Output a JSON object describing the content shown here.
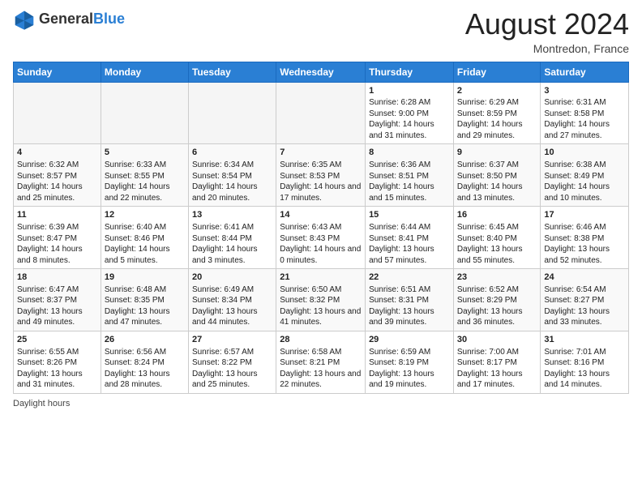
{
  "header": {
    "logo_general": "General",
    "logo_blue": "Blue",
    "month_year": "August 2024",
    "location": "Montredon, France"
  },
  "days_of_week": [
    "Sunday",
    "Monday",
    "Tuesday",
    "Wednesday",
    "Thursday",
    "Friday",
    "Saturday"
  ],
  "weeks": [
    [
      {
        "day": "",
        "info": ""
      },
      {
        "day": "",
        "info": ""
      },
      {
        "day": "",
        "info": ""
      },
      {
        "day": "",
        "info": ""
      },
      {
        "day": "1",
        "info": "Sunrise: 6:28 AM\nSunset: 9:00 PM\nDaylight: 14 hours and 31 minutes."
      },
      {
        "day": "2",
        "info": "Sunrise: 6:29 AM\nSunset: 8:59 PM\nDaylight: 14 hours and 29 minutes."
      },
      {
        "day": "3",
        "info": "Sunrise: 6:31 AM\nSunset: 8:58 PM\nDaylight: 14 hours and 27 minutes."
      }
    ],
    [
      {
        "day": "4",
        "info": "Sunrise: 6:32 AM\nSunset: 8:57 PM\nDaylight: 14 hours and 25 minutes."
      },
      {
        "day": "5",
        "info": "Sunrise: 6:33 AM\nSunset: 8:55 PM\nDaylight: 14 hours and 22 minutes."
      },
      {
        "day": "6",
        "info": "Sunrise: 6:34 AM\nSunset: 8:54 PM\nDaylight: 14 hours and 20 minutes."
      },
      {
        "day": "7",
        "info": "Sunrise: 6:35 AM\nSunset: 8:53 PM\nDaylight: 14 hours and 17 minutes."
      },
      {
        "day": "8",
        "info": "Sunrise: 6:36 AM\nSunset: 8:51 PM\nDaylight: 14 hours and 15 minutes."
      },
      {
        "day": "9",
        "info": "Sunrise: 6:37 AM\nSunset: 8:50 PM\nDaylight: 14 hours and 13 minutes."
      },
      {
        "day": "10",
        "info": "Sunrise: 6:38 AM\nSunset: 8:49 PM\nDaylight: 14 hours and 10 minutes."
      }
    ],
    [
      {
        "day": "11",
        "info": "Sunrise: 6:39 AM\nSunset: 8:47 PM\nDaylight: 14 hours and 8 minutes."
      },
      {
        "day": "12",
        "info": "Sunrise: 6:40 AM\nSunset: 8:46 PM\nDaylight: 14 hours and 5 minutes."
      },
      {
        "day": "13",
        "info": "Sunrise: 6:41 AM\nSunset: 8:44 PM\nDaylight: 14 hours and 3 minutes."
      },
      {
        "day": "14",
        "info": "Sunrise: 6:43 AM\nSunset: 8:43 PM\nDaylight: 14 hours and 0 minutes."
      },
      {
        "day": "15",
        "info": "Sunrise: 6:44 AM\nSunset: 8:41 PM\nDaylight: 13 hours and 57 minutes."
      },
      {
        "day": "16",
        "info": "Sunrise: 6:45 AM\nSunset: 8:40 PM\nDaylight: 13 hours and 55 minutes."
      },
      {
        "day": "17",
        "info": "Sunrise: 6:46 AM\nSunset: 8:38 PM\nDaylight: 13 hours and 52 minutes."
      }
    ],
    [
      {
        "day": "18",
        "info": "Sunrise: 6:47 AM\nSunset: 8:37 PM\nDaylight: 13 hours and 49 minutes."
      },
      {
        "day": "19",
        "info": "Sunrise: 6:48 AM\nSunset: 8:35 PM\nDaylight: 13 hours and 47 minutes."
      },
      {
        "day": "20",
        "info": "Sunrise: 6:49 AM\nSunset: 8:34 PM\nDaylight: 13 hours and 44 minutes."
      },
      {
        "day": "21",
        "info": "Sunrise: 6:50 AM\nSunset: 8:32 PM\nDaylight: 13 hours and 41 minutes."
      },
      {
        "day": "22",
        "info": "Sunrise: 6:51 AM\nSunset: 8:31 PM\nDaylight: 13 hours and 39 minutes."
      },
      {
        "day": "23",
        "info": "Sunrise: 6:52 AM\nSunset: 8:29 PM\nDaylight: 13 hours and 36 minutes."
      },
      {
        "day": "24",
        "info": "Sunrise: 6:54 AM\nSunset: 8:27 PM\nDaylight: 13 hours and 33 minutes."
      }
    ],
    [
      {
        "day": "25",
        "info": "Sunrise: 6:55 AM\nSunset: 8:26 PM\nDaylight: 13 hours and 31 minutes."
      },
      {
        "day": "26",
        "info": "Sunrise: 6:56 AM\nSunset: 8:24 PM\nDaylight: 13 hours and 28 minutes."
      },
      {
        "day": "27",
        "info": "Sunrise: 6:57 AM\nSunset: 8:22 PM\nDaylight: 13 hours and 25 minutes."
      },
      {
        "day": "28",
        "info": "Sunrise: 6:58 AM\nSunset: 8:21 PM\nDaylight: 13 hours and 22 minutes."
      },
      {
        "day": "29",
        "info": "Sunrise: 6:59 AM\nSunset: 8:19 PM\nDaylight: 13 hours and 19 minutes."
      },
      {
        "day": "30",
        "info": "Sunrise: 7:00 AM\nSunset: 8:17 PM\nDaylight: 13 hours and 17 minutes."
      },
      {
        "day": "31",
        "info": "Sunrise: 7:01 AM\nSunset: 8:16 PM\nDaylight: 13 hours and 14 minutes."
      }
    ]
  ],
  "footer": {
    "daylight_hours_label": "Daylight hours"
  }
}
